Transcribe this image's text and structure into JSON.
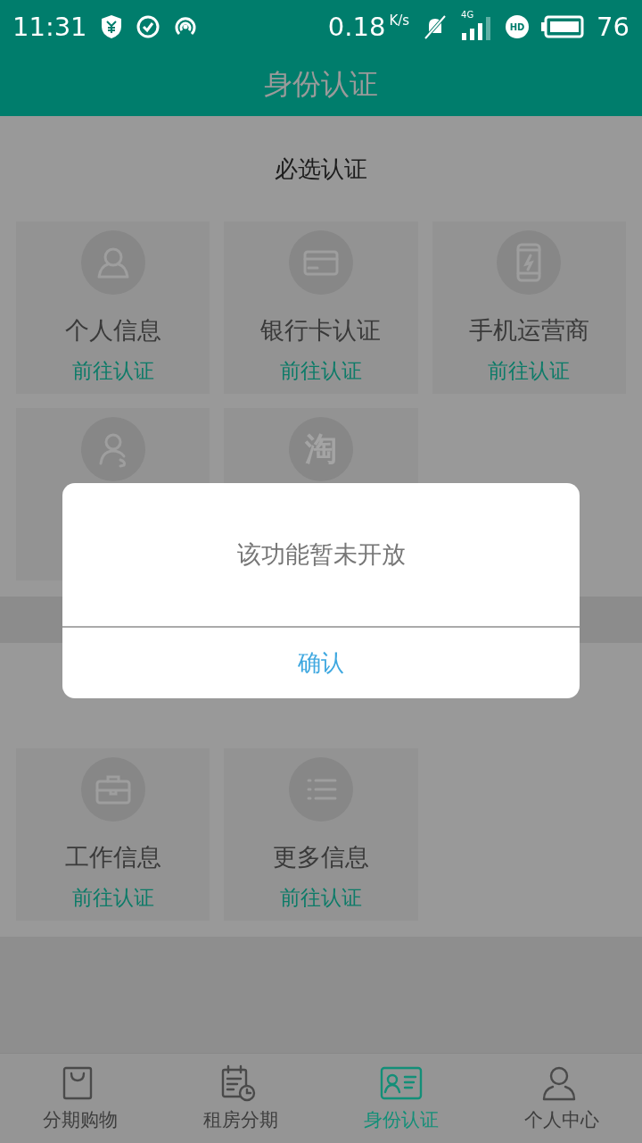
{
  "status_bar": {
    "time": "11:31",
    "speed": "0.18",
    "speed_unit": "K/s",
    "network": "4G",
    "hd": "HD",
    "battery": "76"
  },
  "header": {
    "title": "身份认证"
  },
  "sections": [
    {
      "title": "必选认证",
      "cards": [
        {
          "kind": "full",
          "title": "个人信息",
          "link": "前往认证"
        },
        {
          "kind": "full",
          "title": "银行卡认证",
          "link": "前往认证"
        },
        {
          "kind": "full",
          "title": "手机运营商",
          "link": "前往认证"
        },
        {
          "kind": "icon"
        },
        {
          "kind": "glyph",
          "glyph": "淘"
        }
      ]
    },
    {
      "cards": [
        {
          "kind": "full",
          "title": "工作信息",
          "link": "前往认证"
        },
        {
          "kind": "full",
          "title": "更多信息",
          "link": "前往认证"
        }
      ]
    }
  ],
  "dialog": {
    "message": "该功能暂未开放",
    "button": "确认"
  },
  "tabs": [
    {
      "label": "分期购物",
      "selected": false
    },
    {
      "label": "租房分期",
      "selected": false
    },
    {
      "label": "身份认证",
      "selected": true
    },
    {
      "label": "个人中心",
      "selected": false
    }
  ]
}
